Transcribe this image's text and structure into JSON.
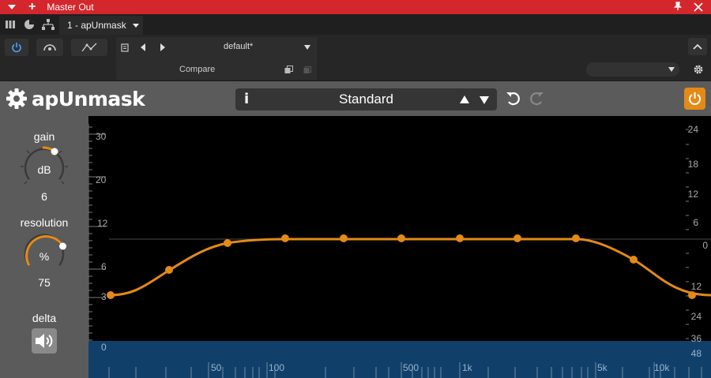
{
  "window": {
    "title": "Master Out",
    "plugin_slot": "1 - apUnmask"
  },
  "toolbar": {
    "preset_name": "default*",
    "compare_label": "Compare",
    "right_select_value": ""
  },
  "plugin": {
    "name": "apUnmask",
    "preset": "Standard",
    "accent_color": "#e38a17"
  },
  "controls": {
    "gain": {
      "label": "gain",
      "unit": "dB",
      "value": "6",
      "fraction": 0.55
    },
    "resolution": {
      "label": "resolution",
      "unit": "%",
      "value": "75",
      "fraction": 0.75
    },
    "delta": {
      "label": "delta",
      "icon": "speaker-icon"
    }
  },
  "graph": {
    "left_axis": [
      "30",
      "20",
      "12",
      "6",
      "3",
      "0"
    ],
    "right_axis": [
      "24",
      "18",
      "12",
      "6",
      "0",
      "12",
      "24",
      "36",
      "48"
    ],
    "freq_axis": [
      "50",
      "100",
      "500",
      "1k",
      "5k",
      "10k"
    ],
    "curve_color": "#e38a17",
    "floor_color": "#10406a"
  }
}
